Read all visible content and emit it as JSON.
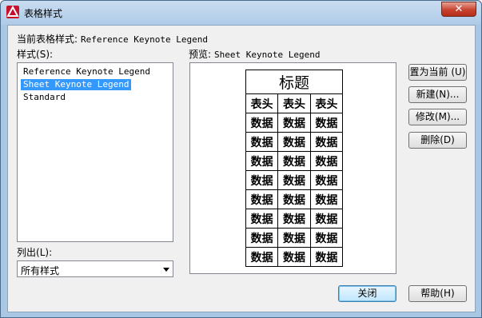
{
  "window": {
    "title": "表格样式",
    "close_glyph": "✕"
  },
  "current_style": {
    "label": "当前表格样式:",
    "value": "Reference Keynote Legend"
  },
  "styles_list": {
    "label": "样式",
    "mnemonic": "(S):",
    "items": [
      "Reference Keynote Legend",
      "Sheet Keynote Legend",
      "Standard"
    ],
    "selected_index": 1
  },
  "list_filter": {
    "label": "列出",
    "mnemonic": "(L):",
    "value": "所有样式"
  },
  "preview": {
    "label": "预览:",
    "style_name": "Sheet Keynote Legend",
    "table_title": "标题",
    "header_cells": [
      "表头",
      "表头",
      "表头"
    ],
    "data_cell": "数据",
    "data_rows": 8
  },
  "buttons": {
    "set_current": "置为当前 (U)",
    "new": "新建(N)...",
    "modify": "修改(M)...",
    "delete": "删除(D)",
    "close": "关闭",
    "help": "帮助(H)"
  },
  "colors": {
    "selection": "#3399ff",
    "titlebar": "#afcbe8",
    "app_icon": "#c8102e"
  }
}
